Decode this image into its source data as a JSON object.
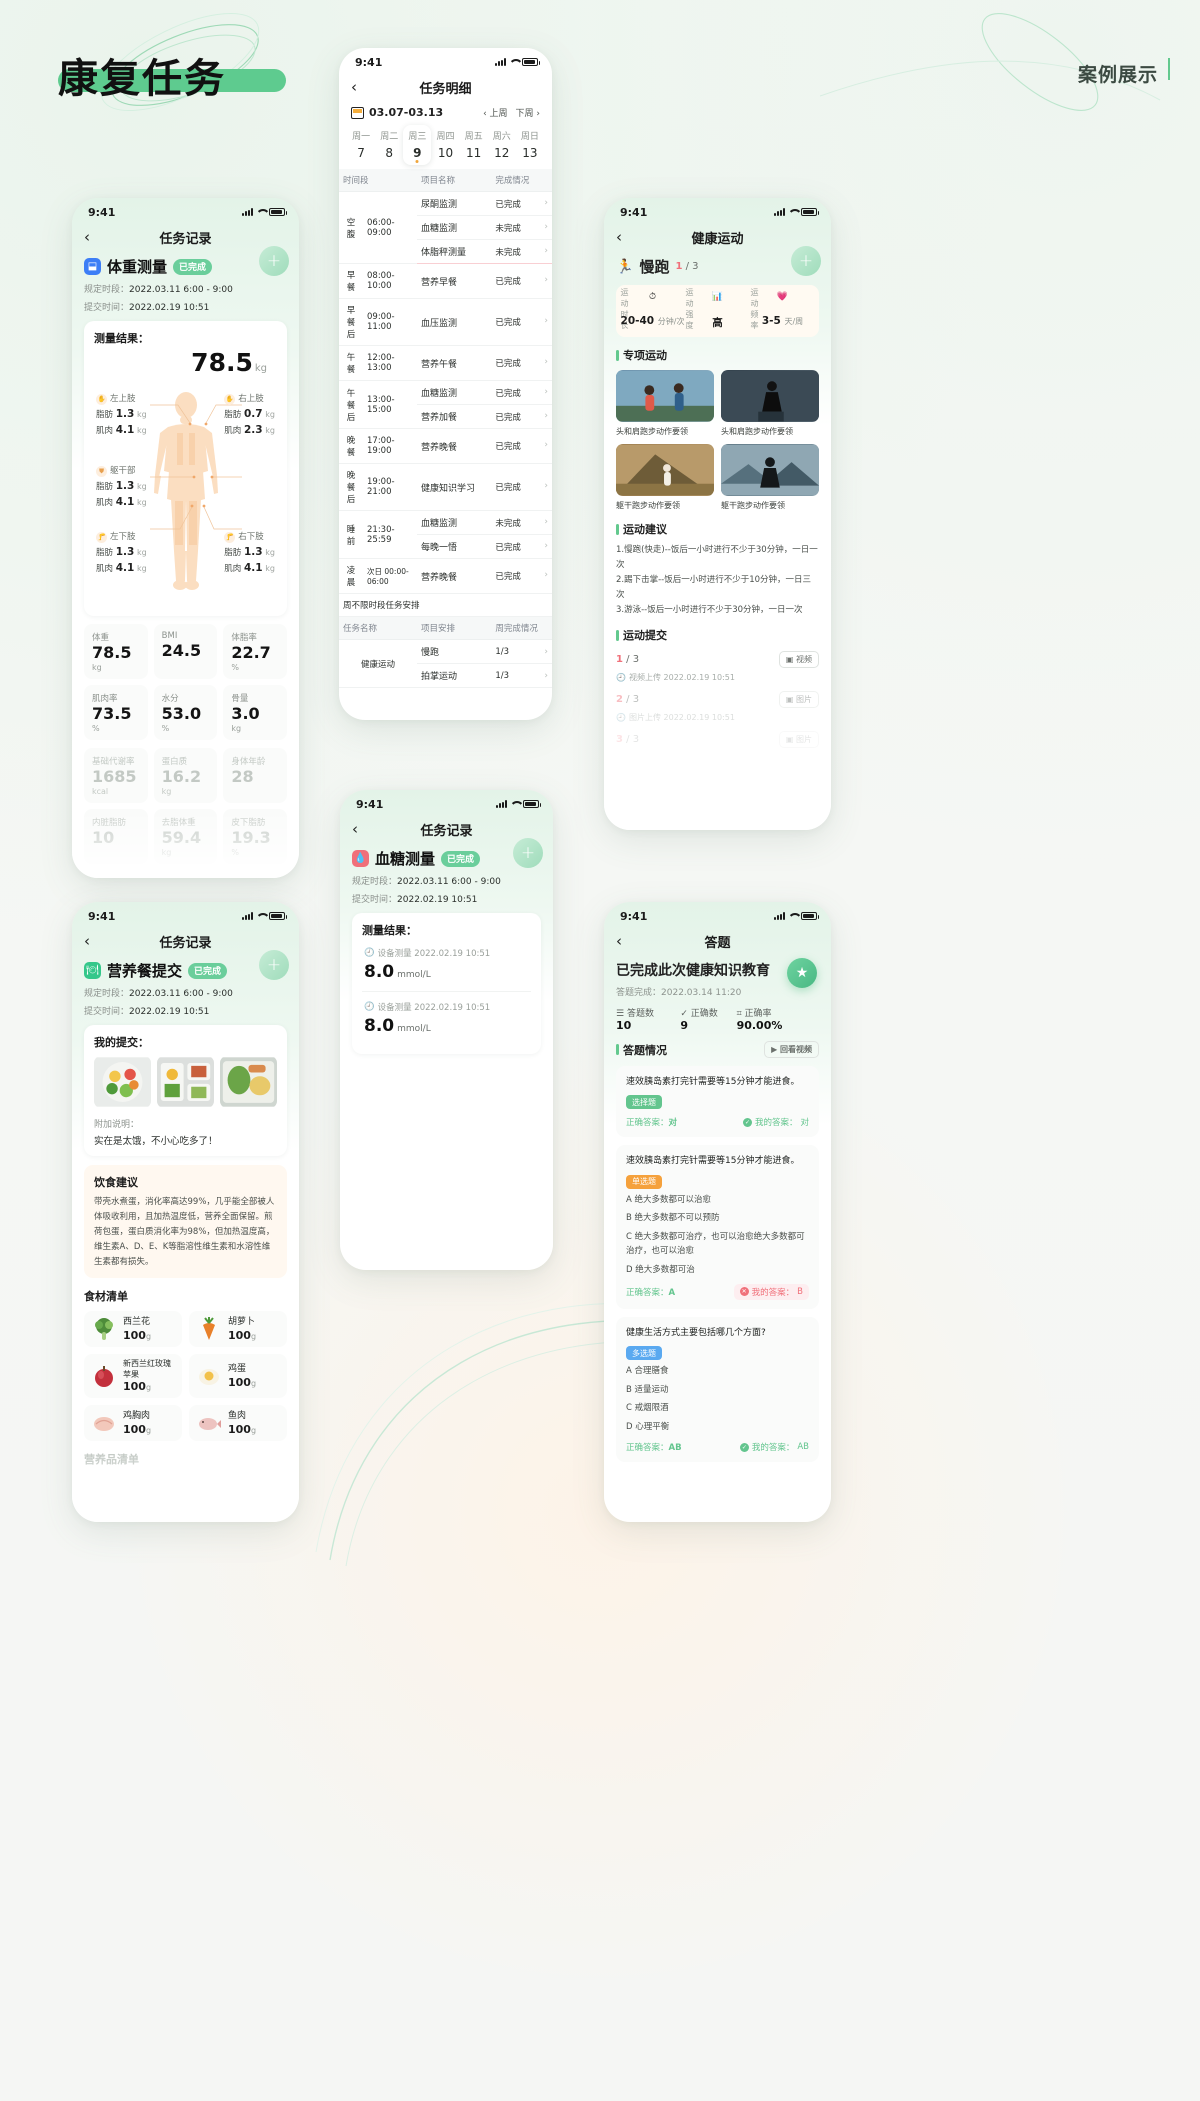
{
  "header": {
    "brand_title": "康复任务",
    "case_label": "案例展示"
  },
  "phone_weight": {
    "status_time": "9:41",
    "nav_title": "任务记录",
    "task_name": "体重测量",
    "task_status": "已完成",
    "meta_period_label": "规定时段：",
    "meta_period_value": "2022.03.11 6:00 - 9:00",
    "meta_submit_label": "提交时间：",
    "meta_submit_value": "2022.02.19 10:51",
    "result_title": "测量结果：",
    "weight_value": "78.5",
    "weight_unit": "kg",
    "limbs": [
      {
        "name": "左上肢",
        "fat_label": "脂肪",
        "fat": "1.3",
        "muscle_label": "肌肉",
        "muscle": "4.1",
        "unit": "kg"
      },
      {
        "name": "右上肢",
        "fat_label": "脂肪",
        "fat": "0.7",
        "muscle_label": "肌肉",
        "muscle": "2.3",
        "unit": "kg"
      },
      {
        "name": "躯干部",
        "fat_label": "脂肪",
        "fat": "1.3",
        "muscle_label": "肌肉",
        "muscle": "4.1",
        "unit": "kg"
      },
      {
        "name": "左下肢",
        "fat_label": "脂肪",
        "fat": "1.3",
        "muscle_label": "肌肉",
        "muscle": "4.1",
        "unit": "kg"
      },
      {
        "name": "右下肢",
        "fat_label": "脂肪",
        "fat": "1.3",
        "muscle_label": "肌肉",
        "muscle": "4.1",
        "unit": "kg"
      }
    ],
    "stats": [
      {
        "key": "体重",
        "value": "78.5",
        "unit": "kg"
      },
      {
        "key": "BMI",
        "value": "24.5",
        "unit": ""
      },
      {
        "key": "体脂率",
        "value": "22.7",
        "unit": "%"
      },
      {
        "key": "肌肉率",
        "value": "73.5",
        "unit": "%"
      },
      {
        "key": "水分",
        "value": "53.0",
        "unit": "%"
      },
      {
        "key": "骨量",
        "value": "3.0",
        "unit": "kg"
      },
      {
        "key": "基础代谢率",
        "value": "1685",
        "unit": "kcal"
      },
      {
        "key": "蛋白质",
        "value": "16.2",
        "unit": "kg"
      },
      {
        "key": "身体年龄",
        "value": "28",
        "unit": ""
      },
      {
        "key": "内脏脂肪",
        "value": "10",
        "unit": ""
      },
      {
        "key": "去脂体重",
        "value": "59.4",
        "unit": "kg"
      },
      {
        "key": "皮下脂肪",
        "value": "19.3",
        "unit": "%"
      }
    ]
  },
  "phone_detail": {
    "status_time": "9:41",
    "nav_title": "任务明细",
    "date_range": "03.07-03.13",
    "prev_week": "‹ 上周",
    "next_week": "下周 ›",
    "days": [
      {
        "w": "周一",
        "d": "7",
        "selected": false
      },
      {
        "w": "周二",
        "d": "8",
        "selected": false
      },
      {
        "w": "周三",
        "d": "9",
        "selected": true
      },
      {
        "w": "周四",
        "d": "10",
        "selected": false
      },
      {
        "w": "周五",
        "d": "11",
        "selected": false
      },
      {
        "w": "周六",
        "d": "12",
        "selected": false
      },
      {
        "w": "周日",
        "d": "13",
        "selected": false
      }
    ],
    "table_headers": [
      "时间段",
      "项目名称",
      "完成情况"
    ],
    "rows": [
      {
        "meal": "空腹",
        "time": "06:00-09:00",
        "name": "尿酮监测",
        "status": "已完成",
        "done": true,
        "rowspan": 3,
        "first": true
      },
      {
        "meal": "",
        "time": "",
        "name": "血糖监测",
        "status": "未完成",
        "done": false,
        "first": false
      },
      {
        "meal": "",
        "time": "",
        "name": "体脂秤测量",
        "status": "未完成",
        "done": false,
        "first": false,
        "sep": true
      },
      {
        "meal": "早餐",
        "time": "08:00-10:00",
        "name": "营养早餐",
        "status": "已完成",
        "done": true,
        "rowspan": 1,
        "first": true
      },
      {
        "meal": "早餐后",
        "time": "09:00-11:00",
        "name": "血压监测",
        "status": "已完成",
        "done": true,
        "rowspan": 1,
        "first": true
      },
      {
        "meal": "午餐",
        "time": "12:00-13:00",
        "name": "营养午餐",
        "status": "已完成",
        "done": true,
        "rowspan": 1,
        "first": true
      },
      {
        "meal": "午餐后",
        "time": "13:00-15:00",
        "name": "血糖监测",
        "status": "已完成",
        "done": true,
        "rowspan": 2,
        "first": true
      },
      {
        "meal": "",
        "time": "",
        "name": "营养加餐",
        "status": "已完成",
        "done": true,
        "first": false
      },
      {
        "meal": "晚餐",
        "time": "17:00-19:00",
        "name": "营养晚餐",
        "status": "已完成",
        "done": true,
        "rowspan": 1,
        "first": true
      },
      {
        "meal": "晚餐后",
        "time": "19:00-21:00",
        "name": "健康知识学习",
        "status": "已完成",
        "done": true,
        "rowspan": 1,
        "first": true
      },
      {
        "meal": "睡前",
        "time": "21:30-25:59",
        "name": "血糖监测",
        "status": "未完成",
        "done": false,
        "rowspan": 2,
        "first": true
      },
      {
        "meal": "",
        "time": "",
        "name": "每晚一悟",
        "status": "已完成",
        "done": true,
        "first": false
      },
      {
        "meal": "凌晨",
        "time": "次日 00:00-06:00",
        "name": "营养晚餐",
        "status": "已完成",
        "done": true,
        "rowspan": 1,
        "first": true
      }
    ],
    "free_title": "周不限时段任务安排",
    "free_headers": [
      "任务名称",
      "项目安排",
      "周完成情况"
    ],
    "free_rows": [
      {
        "cat": "健康运动",
        "name": "慢跑",
        "progress": "1/3"
      },
      {
        "cat": "",
        "name": "拍掌运动",
        "progress": "1/3"
      }
    ]
  },
  "phone_exercise": {
    "status_time": "9:41",
    "nav_title": "健康运动",
    "ex_name": "慢跑",
    "ex_progress_cur": "1",
    "ex_progress_total": "/ 3",
    "metrics": [
      {
        "key": "运动时长",
        "value": "20-40",
        "unit": "分钟/次",
        "icon": "clock-icon"
      },
      {
        "key": "运动强度",
        "value": "高",
        "unit": "",
        "icon": "bar-icon"
      },
      {
        "key": "运动频率",
        "value": "3-5",
        "unit": "天/周",
        "icon": "pulse-icon"
      }
    ],
    "section_special": "专项运动",
    "videos": [
      {
        "caption": "头和肩跑步动作要领",
        "c1": "#5c7f9c",
        "c2": "#a8c3cf"
      },
      {
        "caption": "头和肩跑步动作要领",
        "c1": "#2c3a44",
        "c2": "#6b7c86"
      },
      {
        "caption": "躯干跑步动作要领",
        "c1": "#8b6a3c",
        "c2": "#c9a97a"
      },
      {
        "caption": "躯干跑步动作要领",
        "c1": "#3d5563",
        "c2": "#7f97a3"
      }
    ],
    "section_advice": "运动建议",
    "advice_text": "1.慢跑(快走)--饭后一小时进行不少于30分钟，一日一次\n2.踢下击掌--饭后一小时进行不少于10分钟，一日三次\n3.游泳--饭后一小时进行不少于30分钟，一日一次",
    "section_upload": "运动提交",
    "uploads": [
      {
        "cur": "1",
        "total": "/ 3",
        "type": "视频",
        "note": "视频上传 2022.02.19 10:51",
        "faded": false
      },
      {
        "cur": "2",
        "total": "/ 3",
        "type": "图片",
        "note": "图片上传 2022.02.19 10:51",
        "faded": true
      },
      {
        "cur": "3",
        "total": "/ 3",
        "type": "图片",
        "note": "",
        "faded": true
      }
    ]
  },
  "phone_nutrition": {
    "status_time": "9:41",
    "nav_title": "任务记录",
    "task_name": "营养餐提交",
    "task_status": "已完成",
    "meta_period_label": "规定时段：",
    "meta_period_value": "2022.03.11 6:00 - 9:00",
    "meta_submit_label": "提交时间：",
    "meta_submit_value": "2022.02.19 10:51",
    "submit_title": "我的提交：",
    "note_label": "附加说明：",
    "note_text": "实在是太饿，不小心吃多了！",
    "advice_title": "饮食建议",
    "advice_text": "带壳水煮蛋，消化率高达99%，几乎能全部被人体吸收利用，且加热温度低，营养全面保留。煎荷包蛋，蛋白质消化率为98%，但加热温度高，维生素A、D、E、K等脂溶性维生素和水溶性维生素都有损失。",
    "food_title": "食材清单",
    "foods": [
      {
        "name": "西兰花",
        "weight": "100",
        "unit": "g",
        "c1": "#4e8c3a",
        "c2": "#86bf5e"
      },
      {
        "name": "胡萝卜",
        "weight": "100",
        "unit": "g",
        "c1": "#e07a2a",
        "c2": "#f2a85c"
      },
      {
        "name": "新西兰红玫瑰苹果",
        "weight": "100",
        "unit": "g",
        "c1": "#b12a38",
        "c2": "#e35f63"
      },
      {
        "name": "鸡蛋",
        "weight": "100",
        "unit": "g",
        "c1": "#e8c05a",
        "c2": "#f6e7a8"
      },
      {
        "name": "鸡胸肉",
        "weight": "100",
        "unit": "g",
        "c1": "#e8b6a8",
        "c2": "#f7ded4"
      },
      {
        "name": "鱼肉",
        "weight": "100",
        "unit": "g",
        "c1": "#d9a0a0",
        "c2": "#f2d8d4"
      }
    ],
    "nutrition_title": "营养品清单"
  },
  "phone_glucose": {
    "status_time": "9:41",
    "nav_title": "任务记录",
    "task_name": "血糖测量",
    "task_status": "已完成",
    "meta_period_label": "规定时段：",
    "meta_period_value": "2022.03.11 6:00 - 9:00",
    "meta_submit_label": "提交时间：",
    "meta_submit_value": "2022.02.19 10:51",
    "result_title": "测量结果：",
    "readings": [
      {
        "source": "设备测量 2022.02.19 10:51",
        "value": "8.0",
        "unit": "mmol/L"
      },
      {
        "source": "设备测量 2022.02.19 10:51",
        "value": "8.0",
        "unit": "mmol/L"
      }
    ]
  },
  "phone_quiz": {
    "status_time": "9:41",
    "nav_title": "答题",
    "title": "已完成此次健康知识教育",
    "subtitle_label": "答题完成：",
    "subtitle_value": "2022.03.14 11:20",
    "stats": [
      {
        "key": "答题数",
        "value": "10",
        "icon": "list-icon"
      },
      {
        "key": "正确数",
        "value": "9",
        "icon": "check-icon"
      },
      {
        "key": "正确率",
        "value": "90.00%",
        "icon": "percent-icon"
      }
    ],
    "section_title": "答题情况",
    "video_btn": "回看视频",
    "questions": [
      {
        "q": "速效胰岛素打完针需要等15分钟才能进食。",
        "tag": "选择题",
        "tag_color": "#63c58e",
        "options": [],
        "correct_label": "正确答案：",
        "correct": "对",
        "my_label": "我的答案：",
        "my": "对",
        "right": true
      },
      {
        "q": "速效胰岛素打完针需要等15分钟才能进食。",
        "tag": "单选题",
        "tag_color": "#f5a13c",
        "options": [
          "A  绝大多数都可以治愈",
          "B  绝大多数都不可以预防",
          "C  绝大多数都可治疗，也可以治愈绝大多数都可治疗，也可以治愈",
          "D  绝大多数都可治"
        ],
        "correct_label": "正确答案：",
        "correct": "A",
        "my_label": "我的答案：",
        "my": "B",
        "right": false
      },
      {
        "q": "健康生活方式主要包括哪几个方面?",
        "tag": "多选题",
        "tag_color": "#5aa9f0",
        "options": [
          "A  合理膳食",
          "B  适量运动",
          "C  戒烟限酒",
          "D  心理平衡"
        ],
        "correct_label": "正确答案：",
        "correct": "AB",
        "my_label": "我的答案：",
        "my": "AB",
        "right": true
      }
    ]
  }
}
